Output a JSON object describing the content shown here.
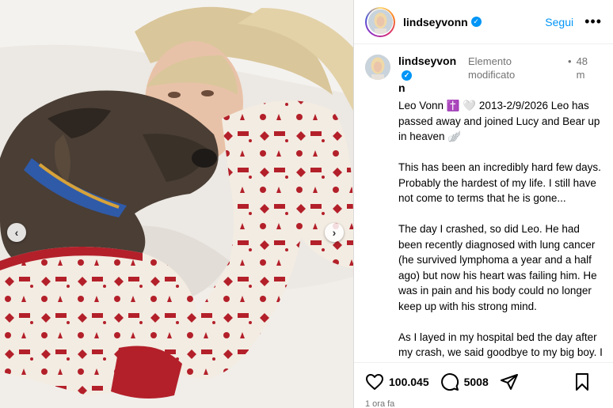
{
  "profile": {
    "username": "lindseyvonn",
    "follow_label": "Segui",
    "more_label": "•••"
  },
  "caption": {
    "username_line1": "lindseyvon",
    "username_line2": "n",
    "edited_label": "Elemento modificato",
    "dot": "•",
    "time_short": "48 m",
    "paragraphs": [
      "Leo Vonn ✝️ 🤍 2013-2/9/2026 Leo has passed away and joined Lucy and Bear up in heaven 🪽",
      "This has been an incredibly hard few days. Probably the hardest of my life. I still have not come to terms that he is gone...",
      "The day I crashed, so did Leo. He had been recently diagnosed with lung cancer (he survived lymphoma a year and a half ago) but now his heart was failing him. He was in pain and his body could no longer keep up with his strong mind.",
      "As I layed in my hospital bed the day after my crash, we said goodbye to my big boy. I had lost so much that meant something to me in such a short amount of time. I can't believe it. My boy has been with me"
    ]
  },
  "actions": {
    "likes": "100.045",
    "comments": "5008",
    "time_ago": "1 ora fa"
  },
  "photo": {
    "prev_arrow": "‹",
    "next_arrow": "›"
  },
  "icons": [
    "verified-badge-icon",
    "heart-icon",
    "comment-icon",
    "share-icon",
    "bookmark-icon",
    "more-icon"
  ],
  "colors": {
    "accent": "#0095f6",
    "pajama_red": "#b3202a",
    "pajama_cream": "#f3ece2"
  }
}
